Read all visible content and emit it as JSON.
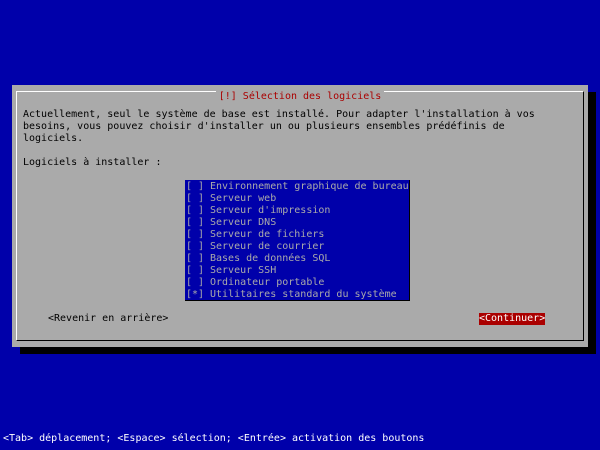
{
  "dialog": {
    "title": "[!] Sélection des logiciels",
    "description": "Actuellement, seul le système de base est installé. Pour adapter l'installation à vos\nbesoins, vous pouvez choisir d'installer un ou plusieurs ensembles prédéfinis de\nlogiciels.",
    "list_label": "Logiciels à installer :",
    "items": [
      {
        "checkbox": "[ ]",
        "label": "Environnement graphique de bureau"
      },
      {
        "checkbox": "[ ]",
        "label": "Serveur web"
      },
      {
        "checkbox": "[ ]",
        "label": "Serveur d'impression"
      },
      {
        "checkbox": "[ ]",
        "label": "Serveur DNS"
      },
      {
        "checkbox": "[ ]",
        "label": "Serveur de fichiers"
      },
      {
        "checkbox": "[ ]",
        "label": "Serveur de courrier"
      },
      {
        "checkbox": "[ ]",
        "label": "Bases de données SQL"
      },
      {
        "checkbox": "[ ]",
        "label": "Serveur SSH"
      },
      {
        "checkbox": "[ ]",
        "label": "Ordinateur portable"
      },
      {
        "checkbox": "[*]",
        "label": "Utilitaires standard du système"
      }
    ],
    "back_label": "<Revenir en arrière>",
    "continue_label": "<Continuer>"
  },
  "help_line": "<Tab> déplacement; <Espace> sélection; <Entrée> activation des boutons",
  "colors": {
    "background": "#0000aa",
    "dialog": "#aaaaaa",
    "title": "#aa0000",
    "list_background": "#0000aa",
    "list_text": "#aaaaaa",
    "focused_button_background": "#aa0000",
    "focused_button_text": "#ffffff",
    "help_text": "#ffffff"
  }
}
